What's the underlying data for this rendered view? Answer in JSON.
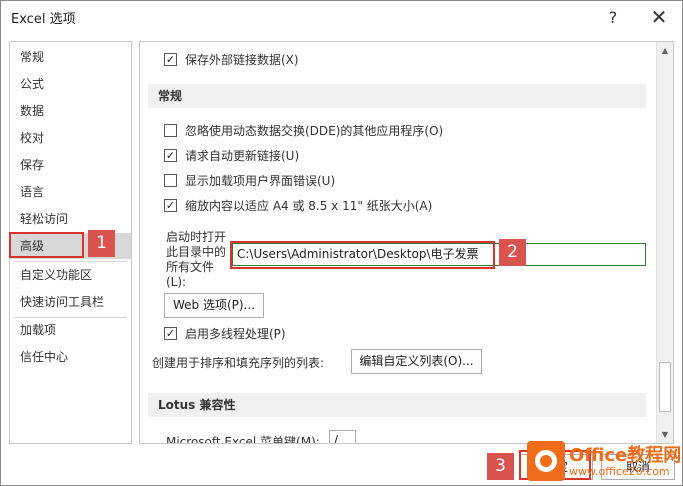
{
  "window": {
    "title": "Excel 选项",
    "help_label": "?",
    "close_label": "✕"
  },
  "sidebar": {
    "items": [
      {
        "label": "常规"
      },
      {
        "label": "公式"
      },
      {
        "label": "数据"
      },
      {
        "label": "校对"
      },
      {
        "label": "保存"
      },
      {
        "label": "语言"
      },
      {
        "label": "轻松访问"
      },
      {
        "label": "高级",
        "selected": true
      },
      {
        "label": "自定义功能区"
      },
      {
        "label": "快速访问工具栏"
      },
      {
        "label": "加载项"
      },
      {
        "label": "信任中心"
      }
    ]
  },
  "content": {
    "save_external_links": {
      "label": "保存外部链接数据(X)",
      "checked": true
    },
    "general_header": "常规",
    "options": [
      {
        "label": "忽略使用动态数据交换(DDE)的其他应用程序(O)",
        "checked": false
      },
      {
        "label": "请求自动更新链接(U)",
        "checked": true
      },
      {
        "label": "显示加载项用户界面错误(U)",
        "checked": false
      },
      {
        "label": "缩放内容以适应 A4 或 8.5 x 11\" 纸张大小(A)",
        "checked": true
      }
    ],
    "startup_label": "启动时打开此目录中的所有文件(L):",
    "startup_path": "C:\\Users\\Administrator\\Desktop\\电子发票",
    "web_options_label": "Web 选项(P)...",
    "multithread": {
      "label": "启用多线程处理(P)",
      "checked": true
    },
    "list_label": "创建用于排序和填充序列的列表:",
    "edit_list_label": "编辑自定义列表(O)...",
    "lotus_header": "Lotus 兼容性",
    "menu_key_label": "Microsoft Excel 菜单键(M):",
    "menu_key_value": "/"
  },
  "footer": {
    "ok_label": "确定",
    "cancel_label": "取消"
  },
  "annotations": {
    "badge1": "1",
    "badge2": "2",
    "badge3": "3",
    "color": "#d9534f"
  },
  "watermark": {
    "brand": "Office教程网",
    "url": "www.office26.com"
  },
  "check_mark": "✓"
}
